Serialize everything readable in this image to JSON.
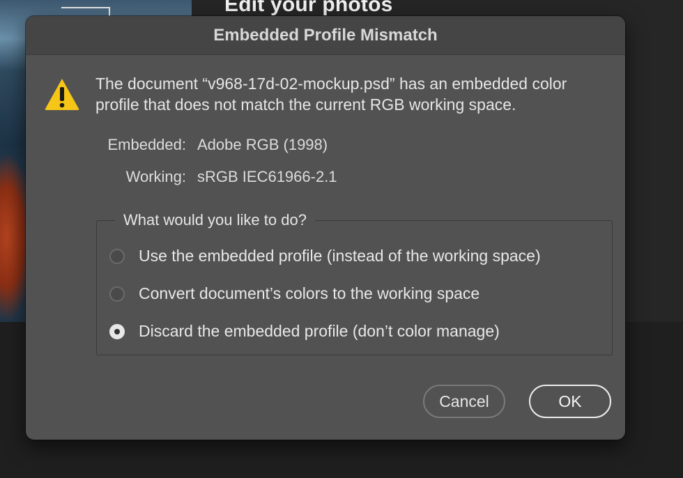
{
  "background": {
    "heading": "Edit your photos"
  },
  "dialog": {
    "title": "Embedded Profile Mismatch",
    "message": "The document “v968-17d-02-mockup.psd” has an embedded color profile that does not match the current RGB working space.",
    "embedded_label": "Embedded:",
    "embedded_value": "Adobe RGB (1998)",
    "working_label": "Working:",
    "working_value": "sRGB IEC61966-2.1",
    "group_label": "What would you like to do?",
    "options": [
      {
        "label": "Use the embedded profile (instead of the working space)",
        "checked": false
      },
      {
        "label": "Convert document’s colors to the working space",
        "checked": false
      },
      {
        "label": "Discard the embedded profile (don’t color manage)",
        "checked": true
      }
    ],
    "cancel_label": "Cancel",
    "ok_label": "OK",
    "icon": "warning-icon",
    "accent_warning": "#f5c518"
  }
}
